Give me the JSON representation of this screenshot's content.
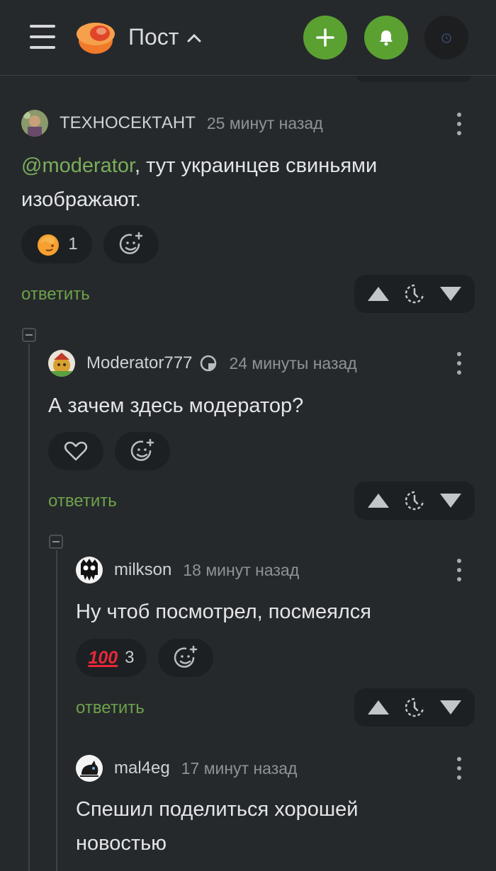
{
  "header": {
    "title": "Пост"
  },
  "comments": [
    {
      "author": "ТЕХНОСЕКТАНТ",
      "time": "25 минут назад",
      "mention": "@moderator",
      "text_rest": ", тут украинцев свиньями изображают.",
      "reaction_count": "1",
      "reply_label": "ответить"
    },
    {
      "author": "Moderator777",
      "time": "24 минуты назад",
      "text": "А зачем здесь модератор?",
      "reply_label": "ответить"
    },
    {
      "author": "milkson",
      "time": "18 минут назад",
      "text": "Ну чтоб посмотрел, посмеялся",
      "reaction_emoji": "100",
      "reaction_count": "3",
      "reply_label": "ответить"
    },
    {
      "author": "mal4eg",
      "time": "17 минут назад",
      "text": "Спешил поделиться хорошей новостью"
    }
  ],
  "colors": {
    "accent": "#5aa132",
    "link": "#6da24a",
    "background": "#26292c",
    "panel": "#1d2022"
  }
}
